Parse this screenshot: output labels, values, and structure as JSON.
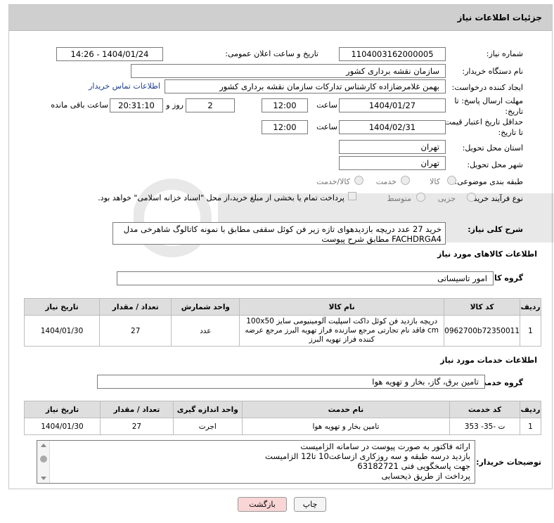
{
  "header": {
    "title": "جزئیات اطلاعات نیاز"
  },
  "fields": {
    "need_number_label": "شماره نیاز:",
    "need_number": "1104003162000005",
    "announce_label": "تاریخ و ساعت اعلان عمومی:",
    "announce_value": "1404/01/24 - 14:26",
    "buyer_org_label": "نام دستگاه خریدار:",
    "buyer_org": "سازمان نقشه برداری کشور",
    "creator_label": "ایجاد کننده درخواست:",
    "creator": "بهمن غلامرضازاده کارشناس تدارکات  سازمان نقشه برداری کشور",
    "contact_link": "اطلاعات تماس خریدار",
    "deadline_label": "مهلت ارسال پاسخ: تا تاریخ:",
    "deadline_date": "1404/01/27",
    "time_label": "ساعت",
    "deadline_time": "12:00",
    "days_value": "2",
    "days_label": "روز و",
    "remaining_time": "20:31:10",
    "remaining_label": "ساعت باقی مانده",
    "validity_label": "حداقل تاریخ اعتبار قیمت: تا تاریخ:",
    "validity_date": "1404/02/31",
    "validity_time": "12:00",
    "province_label": "استان محل تحویل:",
    "province": "تهران",
    "city_label": "شهر محل تحویل:",
    "city": "تهران",
    "category_label": "طبقه بندی موضوعی:",
    "category_options": [
      "کالا",
      "خدمت",
      "کالا/خدمت"
    ],
    "process_label": "نوع فرآیند خرید :",
    "process_options": [
      "جزیی",
      "متوسط"
    ],
    "payment_note": "پرداخت تمام یا بخشی از مبلغ خرید،از محل \"اسناد خزانه اسلامی\" خواهد بود."
  },
  "description": {
    "label": "شرح کلی نیاز:",
    "text": "خرید 27 عدد دریچه بازدیدهوای تازه زیر فن کوئل سقفی مطابق با نمونه کاتالوگ شاهرخی مدل FACHDRGA4 مطابق شرح پیوست"
  },
  "goods": {
    "section_title": "اطلاعات کالاهای مورد نیاز",
    "group_label": "گروه کالا:",
    "group_value": "امور تاسیساتی",
    "headers": [
      "ردیف",
      "کد کالا",
      "نام کالا",
      "واحد شمارش",
      "تعداد / مقدار",
      "تاریخ نیاز"
    ],
    "rows": [
      {
        "index": "1",
        "code": "0962700b72350011",
        "name": "دریچه بازدید فن کوئل داکت اسپلیت آلومینیومی سایز 100x50 cm فاقد نام تجارتی مرجع سازنده فراز تهویه البرز مرجع عرضه کننده فراز تهویه البرز",
        "unit": "عدد",
        "qty": "27",
        "date": "1404/01/30"
      }
    ]
  },
  "services": {
    "section_title": "اطلاعات خدمات مورد نیاز",
    "group_label": "گروه خدمت:",
    "group_value": "تامین برق، گاز، بخار و تهویه هوا",
    "headers": [
      "ردیف",
      "کد خدمت",
      "نام خدمت",
      "واحد اندازه گیری",
      "تعداد / مقدار",
      "تاریخ نیاز"
    ],
    "rows": [
      {
        "index": "1",
        "code": "ت -35- 353",
        "name": "تامین بخار و تهویه هوا",
        "unit": "اجرت",
        "qty": "27",
        "date": "1404/01/30"
      }
    ]
  },
  "buyer_notes": {
    "label": "توضیحات خریدار:",
    "lines": [
      "ارائه فاکتور به صورت پیوست در سامانه  الزامیست",
      "بازدید درسه طبقه و سه روزکاری ازساعت10 تا12 الزامیست",
      "جهت پاسخگویی فنی 63182721",
      "پرداخت از طریق ذیحسابی"
    ]
  },
  "buttons": {
    "print": "چاپ",
    "back": "بازگشت"
  },
  "colors": {
    "header_bg": "#cfcfcf",
    "link": "#1b3d8f",
    "back_button_bg": "#f9d5d5"
  }
}
